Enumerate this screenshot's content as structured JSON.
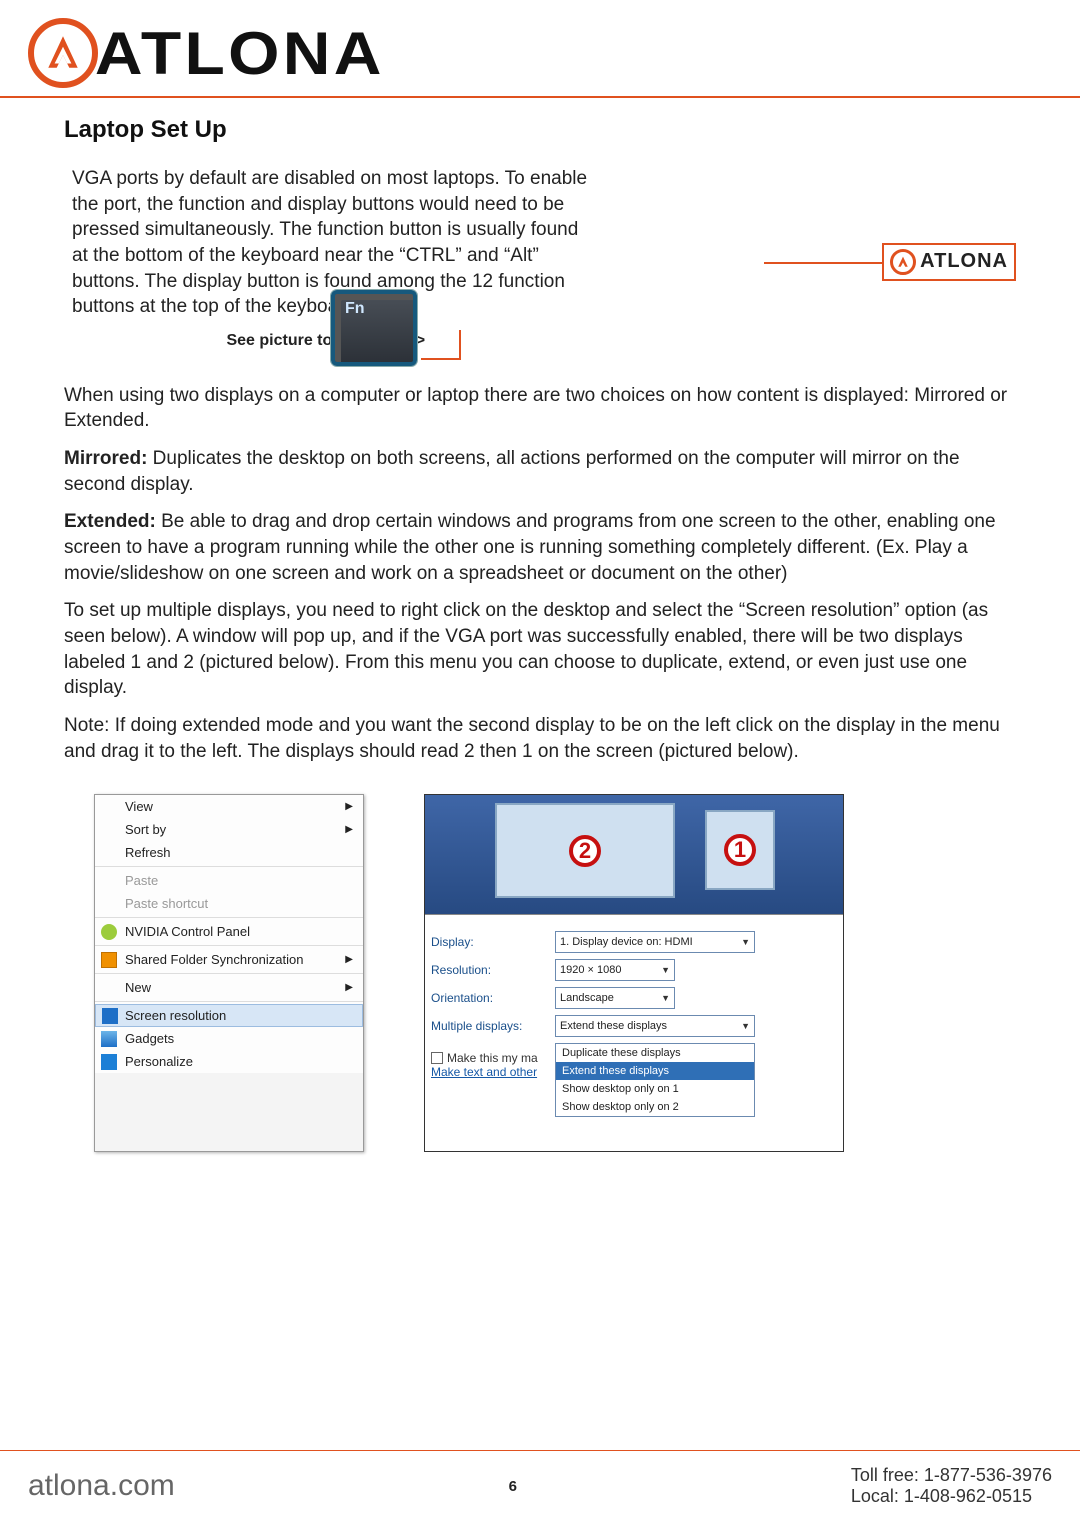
{
  "brand": {
    "wordmark": "ATLONA",
    "mini_wordmark": "ATLONA"
  },
  "section_title": "Laptop Set Up",
  "intro": "VGA ports by default are disabled on most laptops. To enable the port, the function and display buttons would need to be pressed simultaneously. The function button is usually found at the bottom of the keyboard near the “CTRL” and “Alt” buttons. The display button is found among the 12 function buttons at the top of the keyboard.",
  "see_picture": "See picture to the right -->",
  "para2": "When using two displays on a computer or laptop there are two choices on how content is displayed: Mirrored or Extended.",
  "mirrored_label": "Mirrored:",
  "mirrored_text": " Duplicates the desktop on both screens, all actions performed on the computer will mirror on the second display.",
  "extended_label": "Extended:",
  "extended_text": " Be able to drag and drop certain windows and programs from one screen to the other, enabling one screen to have a program running while the other one is running something completely different. (Ex. Play a movie/slideshow on one screen and work on a spreadsheet or document on the other)",
  "setup_text": "To set up multiple displays, you need to right click on the desktop and select the “Screen resolution” option (as seen below). A window will pop up, and if the VGA port was successfully enabled, there will be two displays labeled 1 and 2 (pictured below). From this menu you can choose to duplicate, extend, or even just use one display.",
  "note_text": "Note: If doing extended mode and you want the second display to be on the left click on the display in the menu and drag it to the left. The displays should read 2 then 1 on the screen (pictured below).",
  "context_menu": {
    "items": [
      {
        "label": "View",
        "arrow": true
      },
      {
        "label": "Sort by",
        "arrow": true
      },
      {
        "label": "Refresh"
      },
      {
        "sep": true
      },
      {
        "label": "Paste",
        "disabled": true
      },
      {
        "label": "Paste shortcut",
        "disabled": true
      },
      {
        "sep": true
      },
      {
        "label": "NVIDIA Control Panel",
        "icon": "green"
      },
      {
        "sep": true
      },
      {
        "label": "Shared Folder Synchronization",
        "arrow": true,
        "icon": "orange"
      },
      {
        "sep": true
      },
      {
        "label": "New",
        "arrow": true
      },
      {
        "sep": true
      },
      {
        "label": "Screen resolution",
        "highlight": true,
        "icon": "blue"
      },
      {
        "label": "Gadgets",
        "icon": "pic"
      },
      {
        "label": "Personalize",
        "icon": "desk"
      }
    ]
  },
  "display_window": {
    "monitor1": "1",
    "monitor2": "2",
    "labels": {
      "display": "Display:",
      "resolution": "Resolution:",
      "orientation": "Orientation:",
      "multiple": "Multiple displays:"
    },
    "values": {
      "display": "1. Display device on: HDMI",
      "resolution": "1920 × 1080",
      "orientation": "Landscape",
      "multiple": "Extend these displays"
    },
    "main_check": "Make this my ma",
    "link_text": "Make text and other",
    "dropdown": [
      "Duplicate these displays",
      "Extend these displays",
      "Show desktop only on 1",
      "Show desktop only on 2"
    ]
  },
  "footer": {
    "site": "atlona.com",
    "page": "6",
    "tollfree": "Toll free: 1-877-536-3976",
    "local": "Local: 1-408-962-0515"
  }
}
